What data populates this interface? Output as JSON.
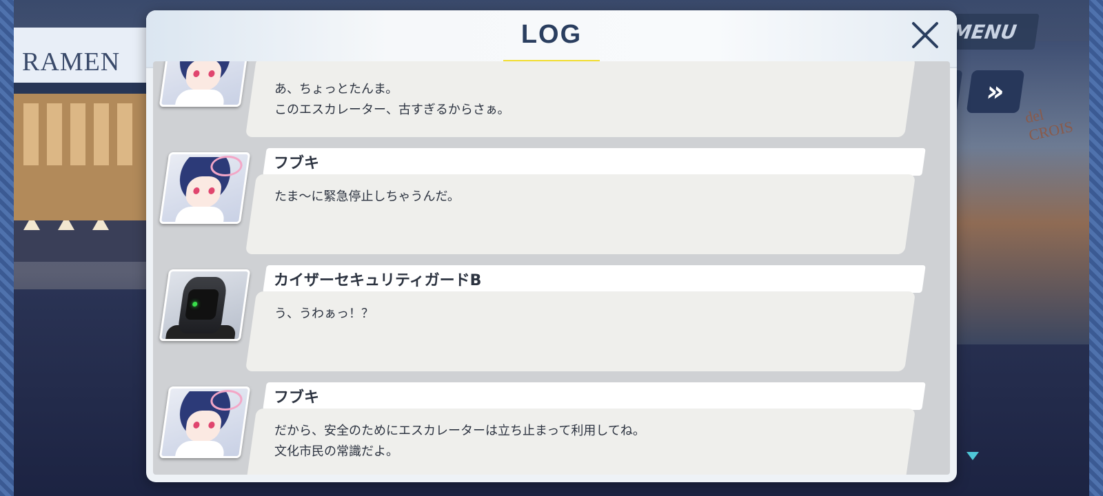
{
  "background": {
    "menu_label": "MENU",
    "skip_label": "»",
    "left_sign": "RAMEN",
    "right_sign": "del CROIS"
  },
  "log_panel": {
    "title": "LOG",
    "close_icon": "close-x-icon",
    "accent_color": "#f2dd2f",
    "title_color": "#2a3e5f",
    "entries": [
      {
        "speaker": "",
        "avatar": "fubuki-portrait",
        "lines": [
          "あ、ちょっとたんま。",
          "このエスカレーター、古すぎるからさぁ。"
        ]
      },
      {
        "speaker": "フブキ",
        "avatar": "fubuki-portrait",
        "lines": [
          "たま～に緊急停止しちゃうんだ。"
        ]
      },
      {
        "speaker": "カイザーセキュリティガードB",
        "avatar": "security-guard-portrait",
        "lines": [
          "う、うわぁっ！？"
        ]
      },
      {
        "speaker": "フブキ",
        "avatar": "fubuki-portrait",
        "lines": [
          "だから、安全のためにエスカレーターは立ち止まって利用してね。",
          "文化市民の常識だよ。"
        ]
      }
    ]
  }
}
